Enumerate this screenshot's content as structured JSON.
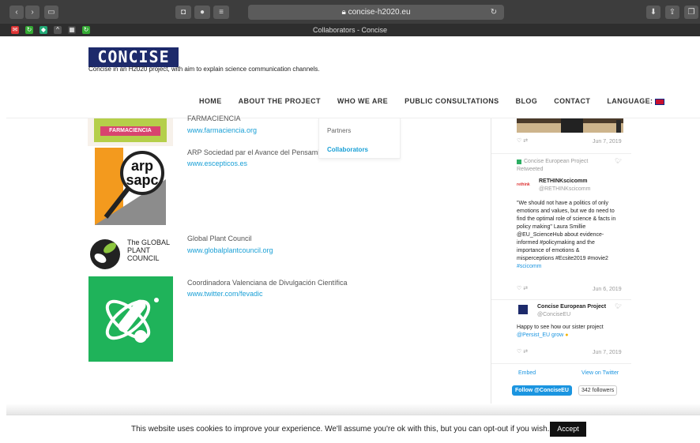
{
  "browser": {
    "url": "concise-h2020.eu",
    "tab_title": "Collaborators - Concise"
  },
  "site": {
    "logo_text": "CONCISE",
    "tagline": "Concise in an H2020 project, with aim to explain science communication channels."
  },
  "nav": {
    "home": "HOME",
    "about": "ABOUT THE PROJECT",
    "who": "WHO WE ARE",
    "public": "PUBLIC CONSULTATIONS",
    "blog": "BLOG",
    "contact": "CONTACT",
    "language": "LANGUAGE:"
  },
  "dropdown": {
    "partners": "Partners",
    "collaborators": "Collaborators"
  },
  "collaborators": [
    {
      "logo": "FARMACIENCIA",
      "name": "FARMACIENCIA",
      "link": "www.farmaciencia.org"
    },
    {
      "logo": "arp sapc",
      "name": "ARP Sociedad par el Avance del Pensamie",
      "link": "www.escepticos.es"
    },
    {
      "logo": "The GLOBAL PLANT COUNCIL",
      "name": "Global Plant Council",
      "link": "www.globalplantcouncil.org"
    },
    {
      "logo": "",
      "name": "Coordinadora Valenciana de Divulgación Científica",
      "link": "www.twitter.com/fevadic"
    }
  ],
  "twitter": {
    "date1": "Jun 7, 2019",
    "retweet_by": "Concise European Project",
    "retweeted": "Retweeted",
    "t1_name": "RETHINKscicomm",
    "t1_handle": "@RETHINKscicomm",
    "t1_logo": "rethink",
    "t1_lines": [
      "\"We should not have a politics of only",
      "emotions and values, but we do need to",
      "find the optimal role of science & facts in",
      "policy making\" Laura Smillie",
      "@EU_ScienceHub about evidence-",
      "informed #policymaking and the",
      "importance of emotions &",
      "misperceptions #Ecsite2019 #movie2",
      "#scicomm"
    ],
    "date2": "Jun 6, 2019",
    "t2_name": "Concise European Project",
    "t2_handle": "@ConciseEU",
    "t2_lines": [
      "Happy to see how our sister project",
      "@Persist_EU grow"
    ],
    "date3": "Jun 7, 2019",
    "embed": "Embed",
    "view": "View on Twitter",
    "follow": "Follow @ConciseEU",
    "followers": "342 followers"
  },
  "cookie": {
    "text": "This website uses cookies to improve your experience. We'll assume you're ok with this, but you can opt-out if you wish.",
    "accept": "Accept"
  },
  "colors": {
    "link": "#1aa0d6",
    "twitter_blue": "#1b95e0",
    "logo_bg": "#1d2a6b",
    "green_tile": "#1fb35a"
  }
}
